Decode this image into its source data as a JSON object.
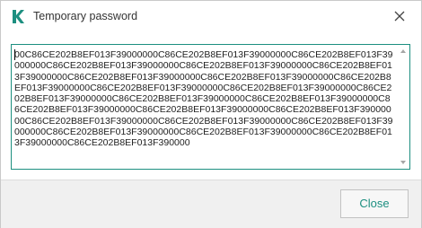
{
  "window": {
    "title": "Temporary password"
  },
  "password": {
    "value": "00C86CE202B8EF013F39000000C86CE202B8EF013F39000000C86CE202B8EF013F39000000C86CE202B8EF013F39000000C86CE202B8EF013F39000000C86CE202B8EF013F39000000C86CE202B8EF013F39000000C86CE202B8EF013F39000000C86CE202B8EF013F39000000C86CE202B8EF013F39000000C86CE202B8EF013F39000000C86CE202B8EF013F39000000C86CE202B8EF013F39000000C86CE202B8EF013F39000000C86CE202B8EF013F39000000C86CE202B8EF013F39000000C86CE202B8EF013F39000000C86CE202B8EF013F39000000C86CE202B8EF013F39000000C86CE202B8EF013F39000000C86CE202B8EF013F39000000C86CE202B8EF013F39000000C86CE202B8EF013F39000000C86CE202B8EF013F390000"
  },
  "footer": {
    "close_label": "Close"
  },
  "colors": {
    "accent": "#1d8f80",
    "footer_bg": "#f0f0f0"
  },
  "icons": {
    "app": "kaspersky-k-icon",
    "close": "close-icon",
    "scroll_up": "scroll-up-arrow-icon",
    "scroll_down": "scroll-down-arrow-icon"
  }
}
